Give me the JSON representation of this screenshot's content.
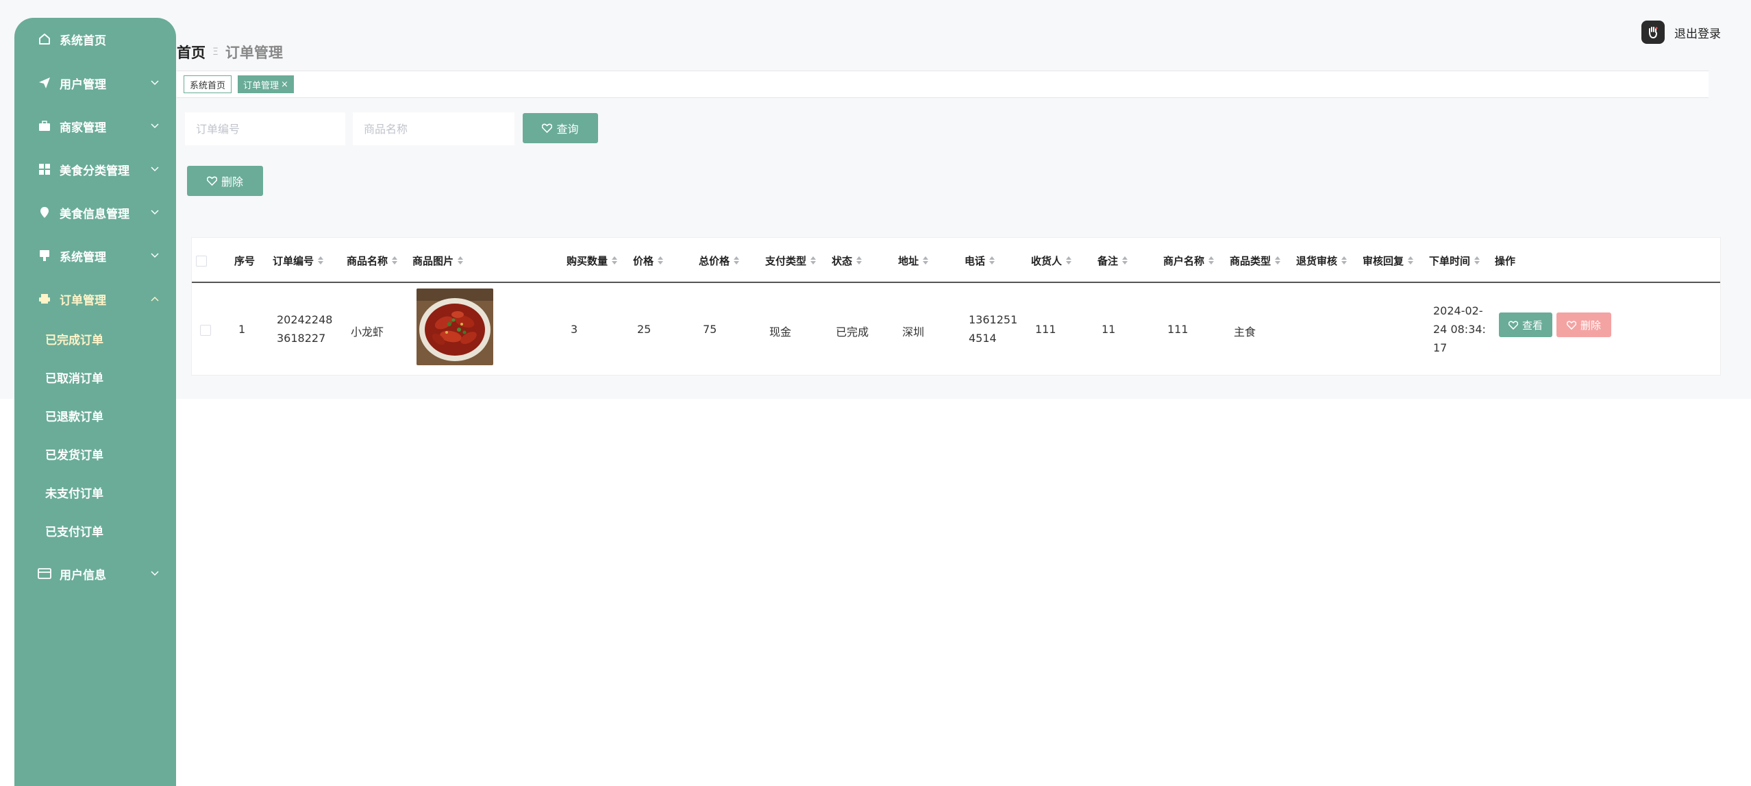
{
  "header": {
    "breadcrumb_home": "首页",
    "breadcrumb_separator": "Ξ",
    "breadcrumb_current": "订单管理",
    "logout_label": "退出登录",
    "logout_icon": "hand-stop-icon"
  },
  "sidebar": {
    "items": [
      {
        "label": "系统首页",
        "icon": "home-icon"
      },
      {
        "label": "用户管理",
        "icon": "send-icon"
      },
      {
        "label": "商家管理",
        "icon": "briefcase-icon"
      },
      {
        "label": "美食分类管理",
        "icon": "grid-icon"
      },
      {
        "label": "美食信息管理",
        "icon": "location-pin-icon"
      },
      {
        "label": "系统管理",
        "icon": "screen-icon"
      },
      {
        "label": "订单管理",
        "icon": "printer-icon"
      },
      {
        "label": "用户信息",
        "icon": "credit-card-icon"
      }
    ],
    "order_subitems": [
      "已完成订单",
      "已取消订单",
      "已退款订单",
      "已发货订单",
      "未支付订单",
      "已支付订单"
    ]
  },
  "tabs": {
    "home": "系统首页",
    "current": "订单管理",
    "close_glyph": "×"
  },
  "search": {
    "order_no_placeholder": "订单编号",
    "product_name_placeholder": "商品名称",
    "query_label": "查询",
    "delete_label": "删除"
  },
  "table": {
    "headers": [
      "序号",
      "订单编号",
      "商品名称",
      "商品图片",
      "购买数量",
      "价格",
      "总价格",
      "支付类型",
      "状态",
      "地址",
      "电话",
      "收货人",
      "备注",
      "商户名称",
      "商品类型",
      "退货审核",
      "审核回复",
      "下单时间",
      "操作"
    ],
    "rows": [
      {
        "index": "1",
        "order_no": "202422483618227",
        "product_name": "小龙虾",
        "quantity": "3",
        "price": "25",
        "total": "75",
        "payment_type": "现金",
        "status": "已完成",
        "address": "深圳",
        "phone": "13612514514",
        "receiver": "111",
        "remark": "11",
        "merchant_name": "111",
        "product_type": "主食",
        "return_review": "",
        "review_reply": "",
        "order_time": "2024-02-24 08:34:17",
        "view_label": "查看",
        "delete_label": "删除"
      }
    ]
  },
  "colors": {
    "primary": "#6aac98",
    "danger": "#f4a3a3",
    "active_menu": "#fff3c8"
  }
}
